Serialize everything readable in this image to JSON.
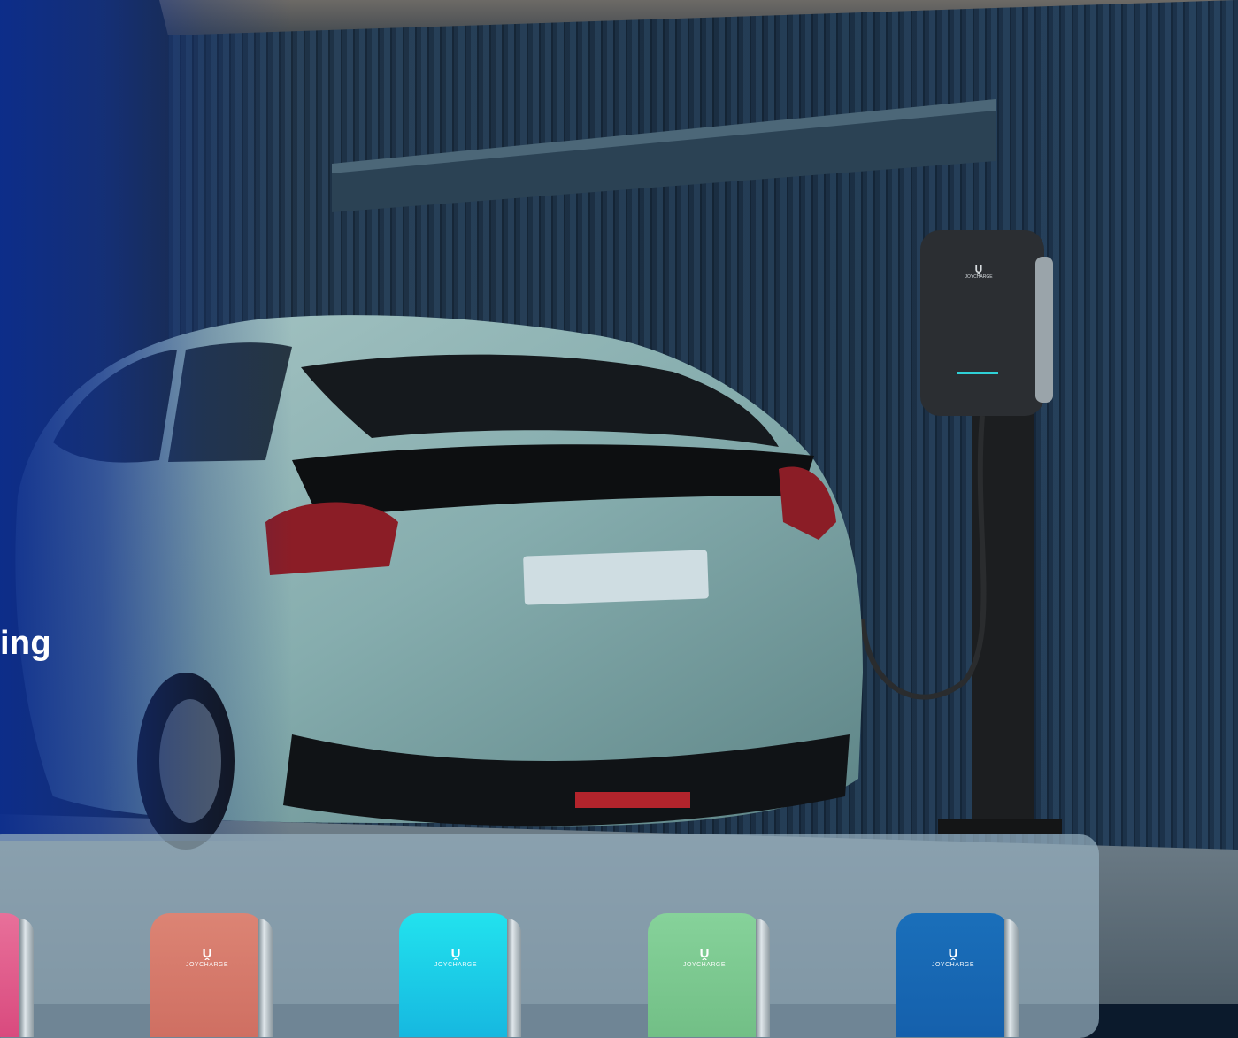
{
  "hero": {
    "headline": "ing",
    "wallbox_brand": "JOYCHARGE"
  },
  "panel": {
    "chargers": [
      {
        "color": "#e05a8a",
        "brand": "",
        "partial": true
      },
      {
        "color": "#d97a6c",
        "brand": "JOYCHARGE"
      },
      {
        "color": "#1ccfe6",
        "brand": "JOYCHARGE"
      },
      {
        "color": "#7cc88f",
        "brand": "JOYCHARGE"
      },
      {
        "color": "#1a68b4",
        "brand": "JOYCHARGE"
      }
    ]
  },
  "colors": {
    "accent_blue": "#1436a0",
    "car_teal": "#8fb3b4",
    "wall_dark": "#15283a"
  }
}
